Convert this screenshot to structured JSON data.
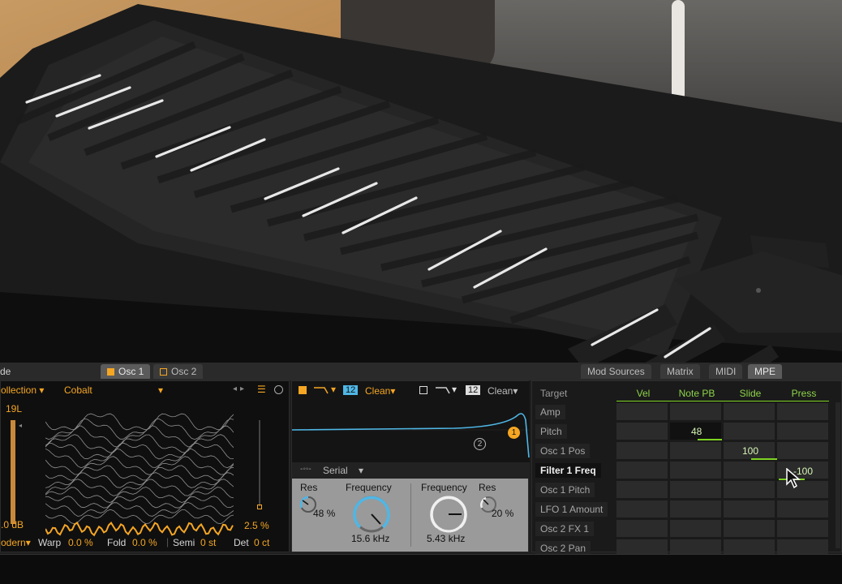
{
  "tabs": {
    "left_stub": "de",
    "osc1": "Osc 1",
    "osc2": "Osc 2"
  },
  "mod_tabs": [
    "Mod Sources",
    "Matrix",
    "MIDI",
    "MPE"
  ],
  "osc": {
    "collection": "ollection",
    "wavetable": "Cobalt",
    "position": "19L",
    "gain": ".0 dB",
    "pos_pct": "2.5 %",
    "mode": "odern",
    "warp_label": "Warp",
    "warp_val": "0.0 %",
    "fold_label": "Fold",
    "fold_val": "0.0 %",
    "semi_label": "Semi",
    "semi_val": "0 st",
    "det_label": "Det",
    "det_val": "0 ct"
  },
  "filter": {
    "f1_num": "12",
    "f1_circuit": "Clean",
    "f2_num": "12",
    "f2_circuit": "Clean",
    "badge1": "1",
    "badge2": "2",
    "routing": "Serial",
    "res_label": "Res",
    "res1_val": "48 %",
    "freq_label": "Frequency",
    "freq1_val": "15.6 kHz",
    "freq2_label": "Frequency",
    "freq2_val": "5.43 kHz",
    "res2_label": "Res",
    "res2_val": "20 %"
  },
  "mpe": {
    "target_header": "Target",
    "columns": [
      "Vel",
      "Note PB",
      "Slide",
      "Press"
    ],
    "targets": [
      "Amp",
      "Pitch",
      "Osc 1 Pos",
      "Filter 1 Freq",
      "Osc 1 Pitch",
      "LFO 1 Amount",
      "Osc 2 FX 1",
      "Osc 2 Pan"
    ],
    "values": {
      "pitch_notepb": "48",
      "osc1pos_slide": "100",
      "filter1freq_press": "-100"
    }
  },
  "colors": {
    "accent": "#f5a623",
    "mpe_green": "#7ed321",
    "filter_curve": "#4fb7e6"
  },
  "icons": [
    "mouse-cursor-icon",
    "dropdown-arrow-icon",
    "list-icon",
    "circle-icon",
    "arrow-left-icon",
    "arrow-right-icon",
    "filter-shape-icon"
  ]
}
